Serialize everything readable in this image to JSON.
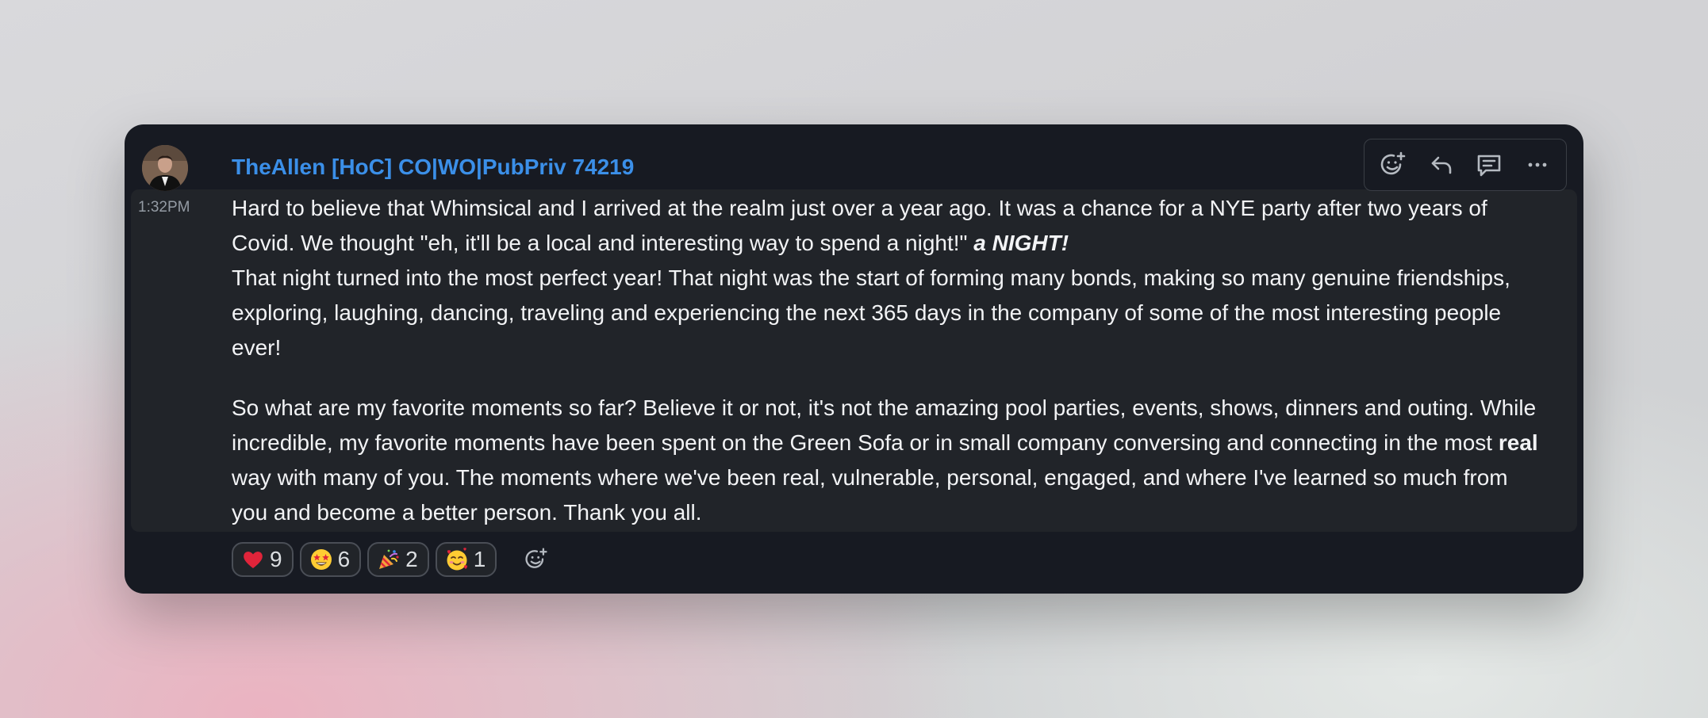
{
  "message": {
    "username": "TheAllen [HoC] CO|WO|PubPriv 74219",
    "timestamp": "1:32PM",
    "paragraph1_part1": "Hard to believe that Whimsical and I arrived at the realm just over a year ago. It was a chance for a NYE party after two years of Covid. We thought \"eh, it'll be a local and interesting way to spend a night!\" ",
    "paragraph1_emphasis": "a NIGHT!",
    "paragraph1_part2": "That night turned into the most perfect year! That night was the start of forming many bonds, making so many genuine friendships, exploring, laughing, dancing, traveling and experiencing the next 365 days in the company of some of the most interesting people ever!",
    "paragraph2_part1": "So what are my favorite moments so far? Believe it or not, it's not the amazing pool parties, events, shows, dinners and outing. While incredible, my favorite moments have been spent on the Green Sofa or in small company conversing and connecting in the most ",
    "paragraph2_bold": "real",
    "paragraph2_part2": " way with many of you. The moments where we've been real, vulnerable, personal, engaged, and where I've learned so much from you and become a better person. Thank you all."
  },
  "toolbar": {
    "icons": [
      "add-reaction-icon",
      "reply-icon",
      "thread-icon",
      "more-icon"
    ]
  },
  "reactions": [
    {
      "emoji": "heart",
      "count": "9"
    },
    {
      "emoji": "star-struck",
      "count": "6"
    },
    {
      "emoji": "party-popper",
      "count": "2"
    },
    {
      "emoji": "smiling-face-with-hearts",
      "count": "1"
    }
  ],
  "colors": {
    "card": "#171a22",
    "hover": "#212429",
    "username": "#3b8fe8",
    "text": "#f2f3f5"
  }
}
